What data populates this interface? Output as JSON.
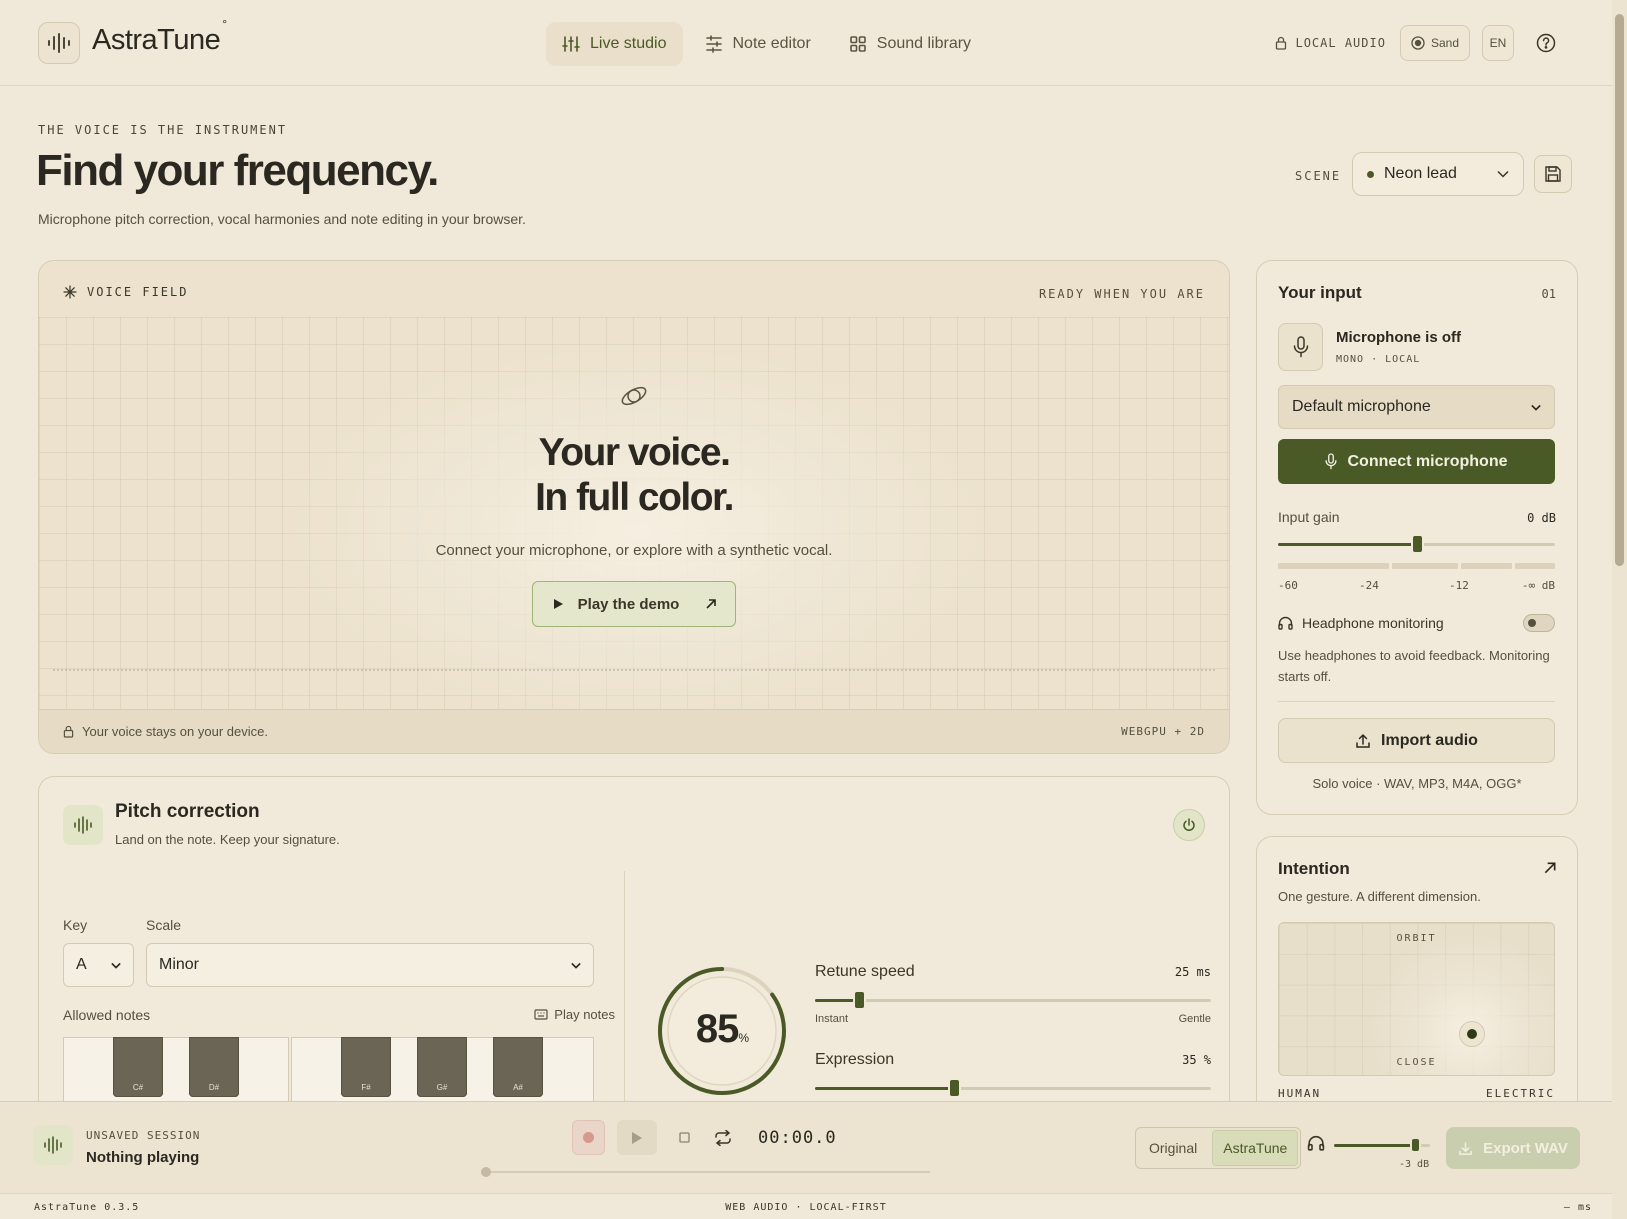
{
  "app": {
    "name": "AstraTune",
    "version": "AstraTune  0.3.5"
  },
  "nav": {
    "items": [
      {
        "label": "Live studio",
        "icon": "sliders-icon",
        "active": true
      },
      {
        "label": "Note editor",
        "icon": "note-editor-icon",
        "active": false
      },
      {
        "label": "Sound library",
        "icon": "grid-icon",
        "active": false
      }
    ]
  },
  "header": {
    "local_audio": "LOCAL AUDIO",
    "theme": "Sand",
    "language": "EN"
  },
  "hero": {
    "eyebrow": "THE VOICE IS THE INSTRUMENT",
    "title": "Find your frequency.",
    "subtitle": "Microphone pitch correction, vocal harmonies and note editing in your browser.",
    "scene_label": "SCENE",
    "scene_value": "Neon lead"
  },
  "voice_field": {
    "label": "VOICE FIELD",
    "status": "READY WHEN YOU ARE",
    "headline_1": "Your voice.",
    "headline_2": "In full color.",
    "body": "Connect your microphone, or explore with a synthetic vocal.",
    "demo_button": "Play the demo",
    "footer_note": "Your voice stays on your device.",
    "renderer": "WEBGPU + 2D"
  },
  "pitch": {
    "title": "Pitch correction",
    "subtitle": "Land on the note. Keep your signature.",
    "key_label": "Key",
    "key_value": "A",
    "scale_label": "Scale",
    "scale_value": "Minor",
    "allowed_label": "Allowed notes",
    "play_notes": "Play notes",
    "black_keys": [
      "C#",
      "D#",
      "F#",
      "G#",
      "A#"
    ],
    "strength": {
      "value": "85",
      "unit": "%",
      "fraction": 0.85
    },
    "retune": {
      "label": "Retune speed",
      "value": "25 ms",
      "fraction": 0.11,
      "min_label": "Instant",
      "max_label": "Gentle"
    },
    "expression": {
      "label": "Expression",
      "value": "35 %",
      "fraction": 0.35
    }
  },
  "input": {
    "title": "Your input",
    "index": "01",
    "mic_status": "Microphone is off",
    "mic_meta": "MONO  ·  LOCAL",
    "device": "Default microphone",
    "connect_button": "Connect microphone",
    "gain_label": "Input gain",
    "gain_value": "0 dB",
    "gain_fraction": 0.5,
    "meter_ticks": [
      "-60",
      "-24",
      "-12",
      "-∞ dB"
    ],
    "headphone_label": "Headphone monitoring",
    "headphone_on": false,
    "headphone_help": "Use headphones to avoid feedback. Monitoring starts off.",
    "import_button": "Import audio",
    "import_help": "Solo voice · WAV, MP3, M4A, OGG*"
  },
  "intention": {
    "title": "Intention",
    "subtitle": "One gesture. A different dimension.",
    "top_label": "ORBIT",
    "bottom_label": "CLOSE",
    "left_label": "HUMAN",
    "right_label": "ELECTRIC"
  },
  "transport": {
    "eyebrow": "UNSAVED SESSION",
    "title": "Nothing playing",
    "time": "00:00.0",
    "ab_original": "Original",
    "ab_processed": "AstraTune",
    "monitor_value": "-3 dB",
    "monitor_fraction": 0.85,
    "export_button": "Export WAV"
  },
  "footer": {
    "center": "WEB AUDIO · LOCAL-FIRST",
    "right": "— ms"
  },
  "colors": {
    "accent": "#4a5a26",
    "background": "#f0e8d8",
    "card": "#f1e9d9"
  }
}
